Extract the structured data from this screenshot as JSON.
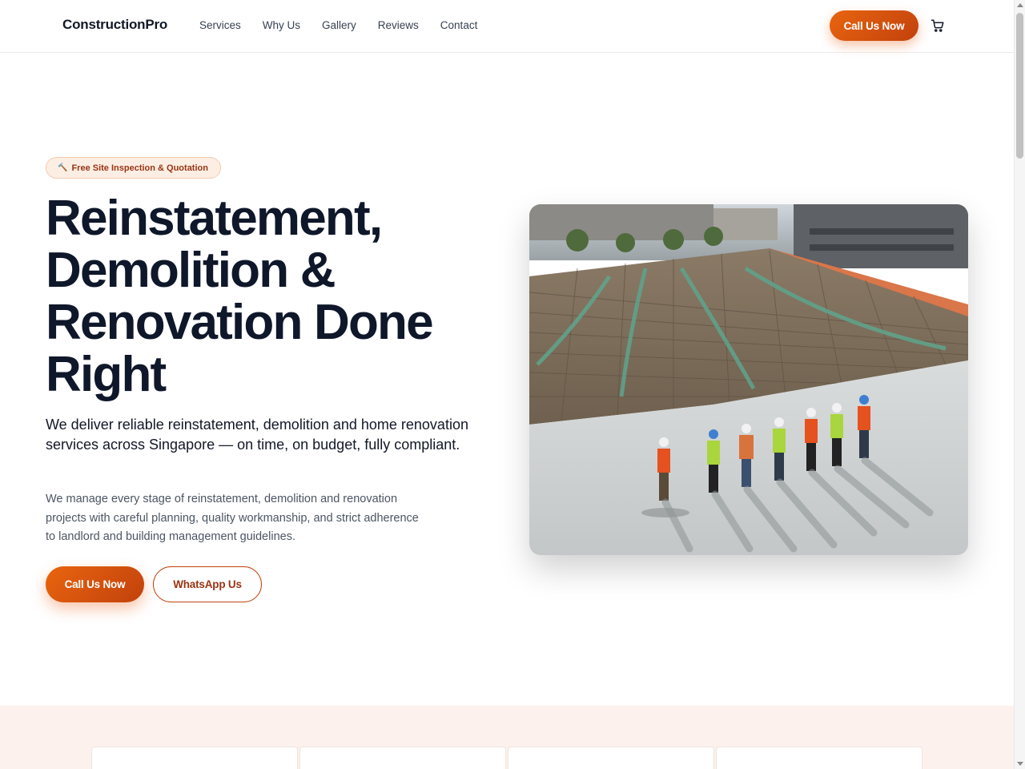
{
  "header": {
    "logo": "ConstructionPro",
    "nav": [
      "Services",
      "Why Us",
      "Gallery",
      "Reviews",
      "Contact"
    ],
    "cta_label": "Call Us Now",
    "cart_icon": "cart-icon"
  },
  "hero": {
    "badge_icon": "hammer-wrench-icon",
    "badge_text": "Free Site Inspection & Quotation",
    "title_lines": [
      "Reinstatement,",
      "Demolition &",
      "Renovation Done",
      "Right"
    ],
    "lead": "We deliver reliable reinstatement, demolition and home renovation services across Singapore — on time, on budget, fully compliant.",
    "body": "We manage every stage of reinstatement, demolition and renovation projects with careful planning, quality workmanship, and strict adherence to landlord and building management guidelines.",
    "primary_button": "Call Us Now",
    "secondary_button": "WhatsApp Us",
    "image_subject": "construction site with workers in hard hats"
  },
  "colors": {
    "accent": "#ea580c",
    "accent_dark": "#c2410c",
    "heading": "#0f172a",
    "section_bg": "#fcf1ec"
  }
}
